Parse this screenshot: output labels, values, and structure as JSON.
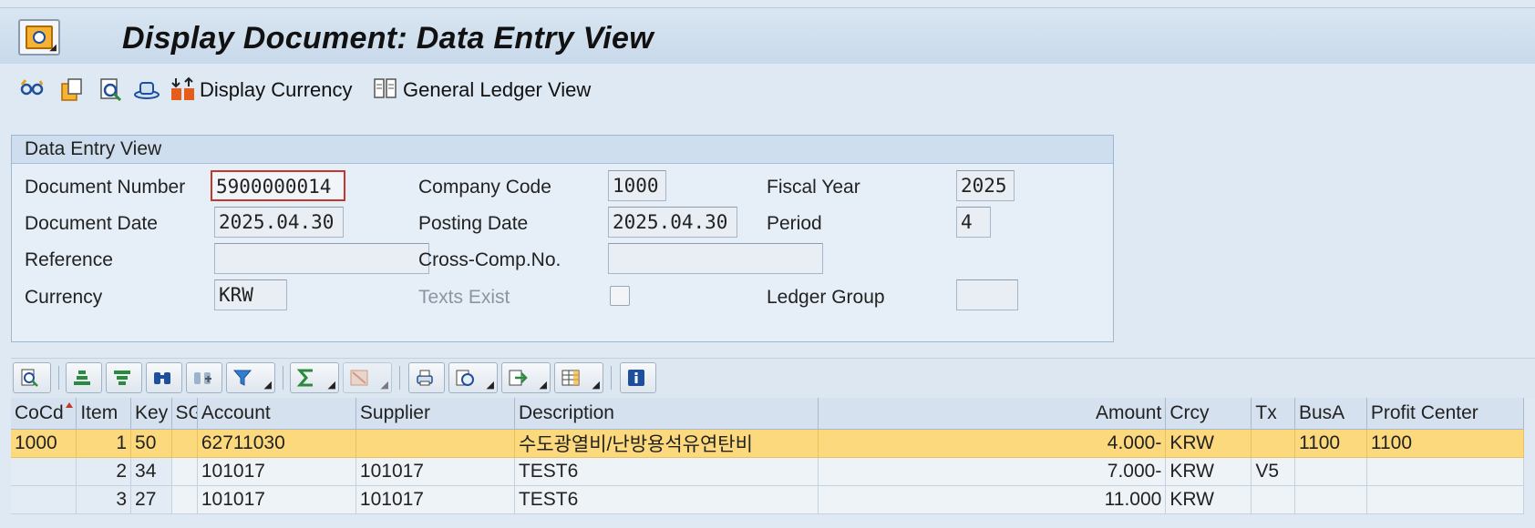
{
  "header": {
    "title": "Display Document: Data Entry View",
    "app_icon": "document-display-icon"
  },
  "toolbar": {
    "icons": [
      "glasses-icon",
      "copy-document-icon",
      "display-document-icon",
      "hat-icon",
      "currency-icon",
      "general-ledger-icon"
    ],
    "display_currency": "Display Currency",
    "general_ledger_view": "General Ledger View"
  },
  "group": {
    "title": "Data Entry View",
    "document_number_label": "Document Number",
    "document_number": "5900000014",
    "company_code_label": "Company Code",
    "company_code": "1000",
    "fiscal_year_label": "Fiscal Year",
    "fiscal_year": "2025",
    "document_date_label": "Document Date",
    "document_date": "2025.04.30",
    "posting_date_label": "Posting Date",
    "posting_date": "2025.04.30",
    "period_label": "Period",
    "period": "4",
    "reference_label": "Reference",
    "reference": "",
    "cross_comp_label": "Cross-Comp.No.",
    "cross_comp": "",
    "currency_label": "Currency",
    "currency": "KRW",
    "texts_exist_label": "Texts Exist",
    "texts_exist": false,
    "ledger_group_label": "Ledger Group",
    "ledger_group": ""
  },
  "alv_toolbar": {
    "buttons": [
      "details-icon",
      "sort-ascending-icon",
      "sort-descending-icon",
      "find-icon",
      "find-next-icon",
      "filter-icon",
      "total-icon",
      "subtotal-icon",
      "print-preview-icon",
      "views-icon",
      "export-icon",
      "layout-icon",
      "info-icon"
    ]
  },
  "table": {
    "columns": [
      "CoCd",
      "Item",
      "Key",
      "SG",
      "Account",
      "Supplier",
      "Description",
      "",
      "Amount",
      "Crcy",
      "Tx",
      "BusA",
      "Profit Center"
    ],
    "rows": [
      [
        "1000",
        "1",
        "50",
        "",
        "62711030",
        "",
        "수도광열비/난방용석유연탄비",
        "",
        "4.000-",
        "KRW",
        "",
        "1100",
        "1100"
      ],
      [
        "",
        "2",
        "34",
        "",
        "101017",
        "101017",
        "TEST6",
        "",
        "7.000-",
        "KRW",
        "V5",
        "",
        ""
      ],
      [
        "",
        "3",
        "27",
        "",
        "101017",
        "101017",
        "TEST6",
        "",
        "11.000",
        "KRW",
        "",
        "",
        ""
      ]
    ],
    "selected_row": 0,
    "sorted_column": "CoCd"
  },
  "colors": {
    "selected_row": "#fbd97c",
    "header_bg": "#d5e1ee",
    "focus_border": "#c0392b"
  }
}
